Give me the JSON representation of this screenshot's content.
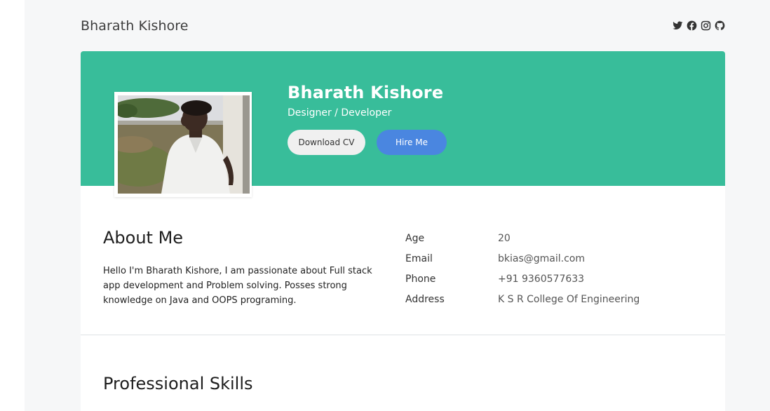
{
  "header": {
    "brand": "Bharath Kishore",
    "social_icons": [
      "twitter-icon",
      "facebook-icon",
      "instagram-icon",
      "github-icon"
    ]
  },
  "hero": {
    "name": "Bharath Kishore",
    "role": "Designer / Developer",
    "download_label": "Download CV",
    "hire_label": "Hire Me",
    "accent_color": "#38bd9a",
    "hire_color": "#4a86e0"
  },
  "about": {
    "title": "About Me",
    "text": "Hello I'm Bharath Kishore, I am passionate about Full stack app development and Problem solving. Posses strong knowledge on Java and OOPS programing."
  },
  "info": [
    {
      "label": "Age",
      "value": "20"
    },
    {
      "label": "Email",
      "value": "bkias@gmail.com"
    },
    {
      "label": "Phone",
      "value": "+91 9360577633"
    },
    {
      "label": "Address",
      "value": "K S R College Of Engineering"
    }
  ],
  "skills": {
    "title": "Professional Skills"
  }
}
